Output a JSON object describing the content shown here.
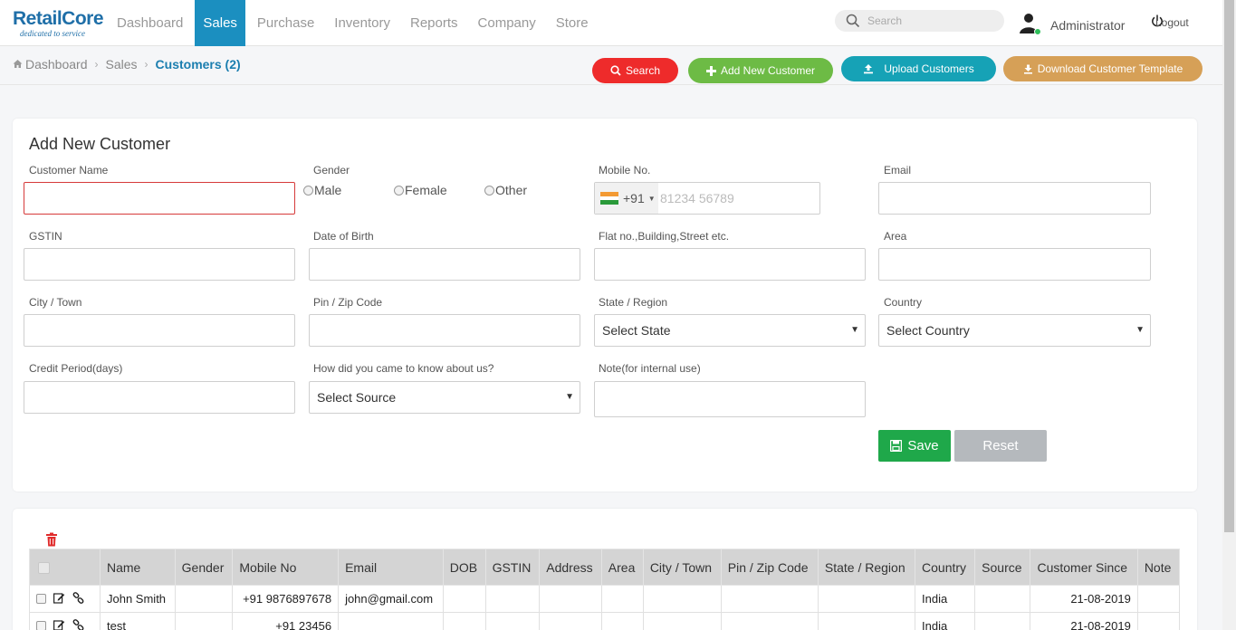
{
  "brand": {
    "name": "RetailCore",
    "tagline": "dedicated to service"
  },
  "nav": {
    "items": [
      {
        "label": "Dashboard",
        "active": false
      },
      {
        "label": "Sales",
        "active": true
      },
      {
        "label": "Purchase",
        "active": false
      },
      {
        "label": "Inventory",
        "active": false
      },
      {
        "label": "Reports",
        "active": false
      },
      {
        "label": "Company",
        "active": false
      },
      {
        "label": "Store",
        "active": false
      }
    ],
    "search_placeholder": "Search",
    "user": "Administrator",
    "logout": "Logout"
  },
  "breadcrumb": {
    "home": "Dashboard",
    "section": "Sales",
    "current": "Customers (2)"
  },
  "actions": {
    "search": "Search",
    "add": "Add New Customer",
    "upload": "Upload Customers",
    "download": "Download Customer Template"
  },
  "form": {
    "title": "Add New Customer",
    "labels": {
      "customer_name": "Customer Name",
      "gender": "Gender",
      "mobile": "Mobile No.",
      "email": "Email",
      "gstin": "GSTIN",
      "dob": "Date of Birth",
      "flat": "Flat no.,Building,Street etc.",
      "area": "Area",
      "city": "City / Town",
      "pin": "Pin / Zip Code",
      "state": "State / Region",
      "country": "Country",
      "credit": "Credit Period(days)",
      "source": "How did you came to know about us?",
      "note": "Note(for internal use)"
    },
    "gender_options": [
      "Male",
      "Female",
      "Other"
    ],
    "phone_code": "+91",
    "phone_placeholder": "81234 56789",
    "state_selected": "Select State",
    "country_selected": "Select Country",
    "source_selected": "Select Source",
    "save": "Save",
    "reset": "Reset"
  },
  "table": {
    "columns": [
      "Name",
      "Gender",
      "Mobile No",
      "Email",
      "DOB",
      "GSTIN",
      "Address",
      "Area",
      "City / Town",
      "Pin / Zip Code",
      "State / Region",
      "Country",
      "Source",
      "Customer Since",
      "Note"
    ],
    "rows": [
      {
        "name": "John Smith",
        "gender": "",
        "mobile": "+91 9876897678",
        "email": "john@gmail.com",
        "dob": "",
        "gstin": "",
        "address": "",
        "area": "",
        "city": "",
        "pin": "",
        "state": "",
        "country": "India",
        "source": "",
        "since": "21-08-2019",
        "note": ""
      },
      {
        "name": "test",
        "gender": "",
        "mobile": "+91 23456",
        "email": "",
        "dob": "",
        "gstin": "",
        "address": "",
        "area": "",
        "city": "",
        "pin": "",
        "state": "",
        "country": "India",
        "source": "",
        "since": "21-08-2019",
        "note": ""
      }
    ]
  },
  "colors": {
    "nav_active": "#1b8fc0",
    "search_btn": "#ee2b2b",
    "add_btn": "#6dbb45",
    "upload_btn": "#16a2b6",
    "download_btn": "#d6a057",
    "save_btn": "#1fa84a",
    "reset_btn": "#b5b9bd"
  }
}
